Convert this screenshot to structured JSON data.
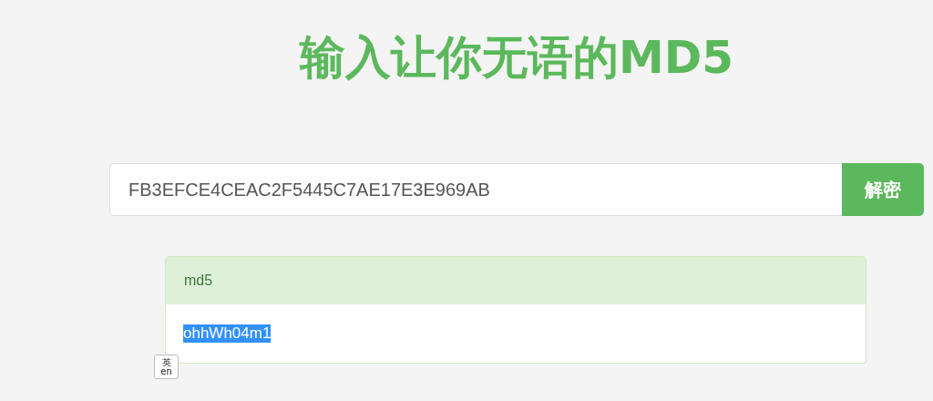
{
  "title": "输入让你无语的MD5",
  "search": {
    "value": "FB3EFCE4CEAC2F5445C7AE17E3E969AB",
    "button": "解密"
  },
  "result": {
    "heading": "md5",
    "value": "ohhWh04m1",
    "selected": true
  },
  "ime_badge": {
    "top": "英",
    "bottom": "en"
  }
}
